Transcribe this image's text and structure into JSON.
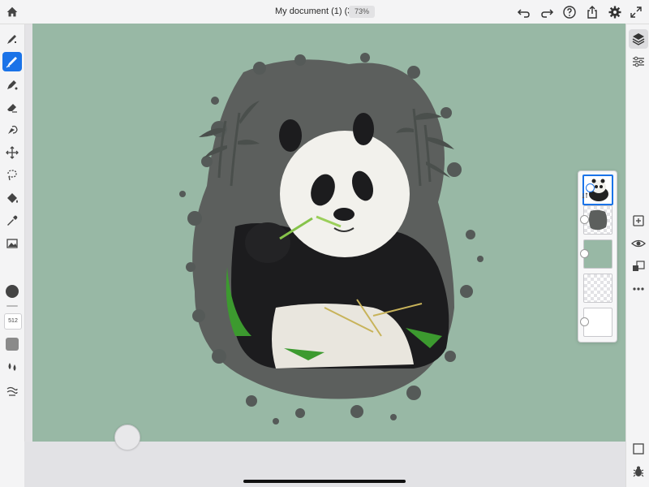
{
  "document": {
    "title": "My document (1) (31)",
    "zoom": "73%"
  },
  "toolbar_top": {
    "left_icons": [
      "home-icon"
    ],
    "right_icons": [
      "undo-icon",
      "redo-icon",
      "help-icon",
      "share-icon",
      "settings-icon",
      "fullscreen-icon"
    ]
  },
  "left_tools": {
    "tools": [
      "pixel-brush-tool",
      "live-brush-tool",
      "vector-brush-tool",
      "eraser-tool",
      "smudge-tool",
      "transform-tool",
      "selection-tool",
      "fill-tool",
      "eyedropper-tool",
      "image-tool"
    ],
    "active_tool": "live-brush-tool",
    "brush_size": "512",
    "colors": {
      "primary": "#444444",
      "swatch": "#8a8a8a",
      "active_accent": "#1a73e8"
    }
  },
  "canvas": {
    "background": "#98b8a5",
    "subject": "panda"
  },
  "layers": {
    "items": [
      {
        "name": "panda-photo-layer",
        "selected": true
      },
      {
        "name": "gray-splatter-layer",
        "selected": false
      },
      {
        "name": "green-background-layer",
        "selected": false
      },
      {
        "name": "empty-layer",
        "selected": false
      },
      {
        "name": "white-layer",
        "selected": false
      }
    ]
  },
  "right_tools": [
    "layers-icon",
    "layer-properties-icon",
    "add-layer-icon",
    "visibility-icon",
    "mask-icon",
    "more-icon",
    "frame-icon",
    "bug-icon"
  ]
}
